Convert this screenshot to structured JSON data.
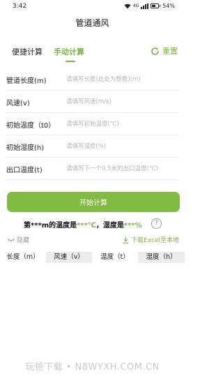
{
  "status_bar": {
    "time": "3:42",
    "network": "4G",
    "battery": "54%"
  },
  "app": {
    "title": "管道通风"
  },
  "tabs": {
    "quick": "便捷计算",
    "manual": "手动计算",
    "reset": "重置"
  },
  "form": {
    "fields": [
      {
        "label": "管道长度(m)",
        "placeholder": "请填写长度(此处为整数)(m)",
        "value": ""
      },
      {
        "label": "风速(v)",
        "placeholder": "请填写风速(m/s)",
        "value": ""
      },
      {
        "label": "初始温度（t0）",
        "placeholder": "请填写初始温度(℃)",
        "value": ""
      },
      {
        "label": "初始湿度(h)",
        "placeholder": "请填写湿度(%)",
        "value": ""
      },
      {
        "label": "出口温度(t)",
        "placeholder": "请填写下一个0.5米的出口温度(℃)",
        "value": ""
      }
    ]
  },
  "start_button": "开始计算",
  "result": {
    "prefix": "第***m的温度是",
    "temperature": "***℃",
    "middle": "，湿度是",
    "humidity": "***%",
    "help": "?"
  },
  "actions": {
    "hide": "隐藏",
    "download": "下载Excel至本地"
  },
  "table": {
    "headers": [
      "长度（m）",
      "风速（v）",
      "温度（t）",
      "湿度（h）"
    ]
  },
  "watermark": "玩爸下载 • N8WYXH.COM.CN",
  "colors": {
    "accent": "#7cb342",
    "button": "#80bc42",
    "header_alt": "#ececec"
  }
}
